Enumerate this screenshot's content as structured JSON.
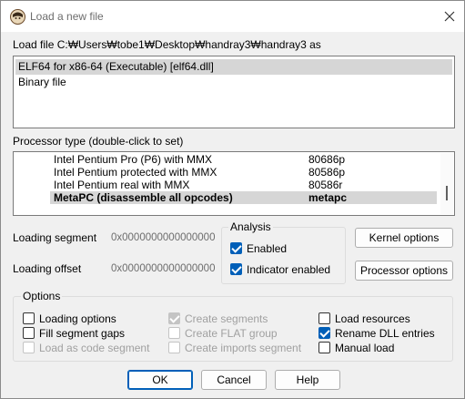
{
  "window": {
    "title": "Load a new file",
    "close_glyph": "✕"
  },
  "load_file_label": "Load file C:₩Users₩tobe1₩Desktop₩handray3₩handray3 as",
  "file_types": [
    {
      "label": "ELF64 for x86-64 (Executable) [elf64.dll]",
      "selected": true
    },
    {
      "label": "Binary file",
      "selected": false
    }
  ],
  "processor": {
    "label": "Processor type (double-click to set)",
    "rows": [
      {
        "name": "Intel Pentium Pro (P6) with MMX",
        "code": "80686p",
        "selected": false
      },
      {
        "name": "Intel Pentium protected with MMX",
        "code": "80586p",
        "selected": false
      },
      {
        "name": "Intel Pentium real with MMX",
        "code": "80586r",
        "selected": false
      },
      {
        "name": "MetaPC (disassemble all opcodes)",
        "code": "metapc",
        "selected": true
      }
    ]
  },
  "loading": {
    "segment_label": "Loading segment",
    "segment_value": "0x0000000000000000",
    "offset_label": "Loading offset",
    "offset_value": "0x0000000000000000"
  },
  "analysis": {
    "title": "Analysis",
    "enabled_label": "Enabled",
    "enabled_checked": true,
    "indicator_label": "Indicator enabled",
    "indicator_checked": true
  },
  "buttons": {
    "kernel": "Kernel options",
    "processor": "Processor options",
    "ok": "OK",
    "cancel": "Cancel",
    "help": "Help"
  },
  "options": {
    "title": "Options",
    "items": {
      "loading_options": {
        "label": "Loading options",
        "checked": false,
        "enabled": true
      },
      "fill_segment_gaps": {
        "label": "Fill segment gaps",
        "checked": false,
        "enabled": true
      },
      "load_as_code_segment": {
        "label": "Load as code segment",
        "checked": false,
        "enabled": false
      },
      "create_segments": {
        "label": "Create segments",
        "checked": true,
        "enabled": false
      },
      "create_flat_group": {
        "label": "Create FLAT group",
        "checked": false,
        "enabled": false
      },
      "create_imports_segment": {
        "label": "Create imports segment",
        "checked": false,
        "enabled": false
      },
      "load_resources": {
        "label": "Load resources",
        "checked": false,
        "enabled": true
      },
      "rename_dll_entries": {
        "label": "Rename DLL entries",
        "checked": true,
        "enabled": true
      },
      "manual_load": {
        "label": "Manual load",
        "checked": false,
        "enabled": true
      }
    }
  },
  "colors": {
    "accent": "#005fb8",
    "selection": "#d6d6d6",
    "disabled_text": "#a0a0a0"
  }
}
